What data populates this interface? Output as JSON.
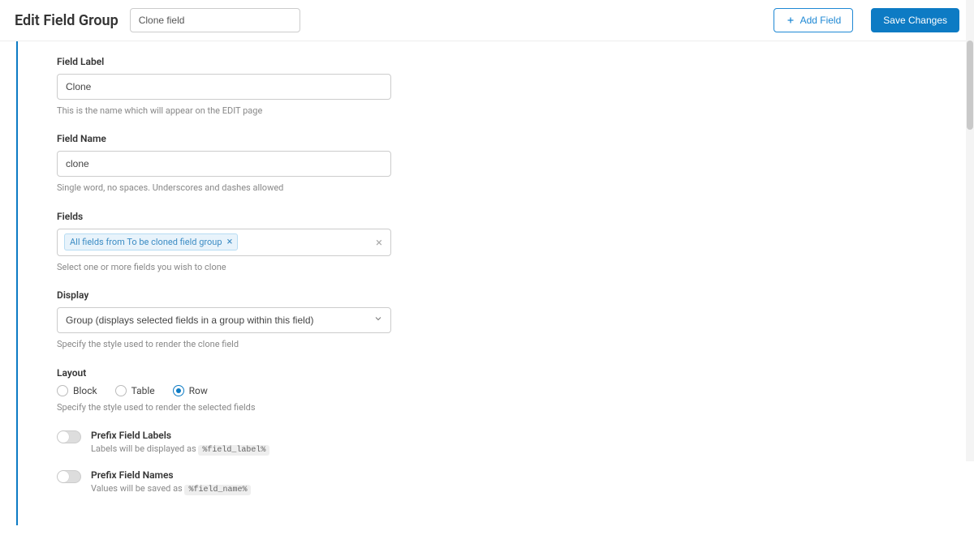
{
  "header": {
    "page_title": "Edit Field Group",
    "group_name_value": "Clone field",
    "add_field_label": "Add Field",
    "save_label": "Save Changes"
  },
  "field_label": {
    "label": "Field Label",
    "value": "Clone",
    "help": "This is the name which will appear on the EDIT page"
  },
  "field_name": {
    "label": "Field Name",
    "value": "clone",
    "help": "Single word, no spaces. Underscores and dashes allowed"
  },
  "fields": {
    "label": "Fields",
    "selected_tag": "All fields from To be cloned field group",
    "help": "Select one or more fields you wish to clone"
  },
  "display": {
    "label": "Display",
    "value": "Group (displays selected fields in a group within this field)",
    "help": "Specify the style used to render the clone field"
  },
  "layout": {
    "label": "Layout",
    "options": {
      "block": "Block",
      "table": "Table",
      "row": "Row"
    },
    "selected": "row",
    "help": "Specify the style used to render the selected fields"
  },
  "prefix_labels": {
    "title": "Prefix Field Labels",
    "desc_prefix": "Labels will be displayed as ",
    "code": "%field_label%"
  },
  "prefix_names": {
    "title": "Prefix Field Names",
    "desc_prefix": "Values will be saved as ",
    "code": "%field_name%"
  }
}
